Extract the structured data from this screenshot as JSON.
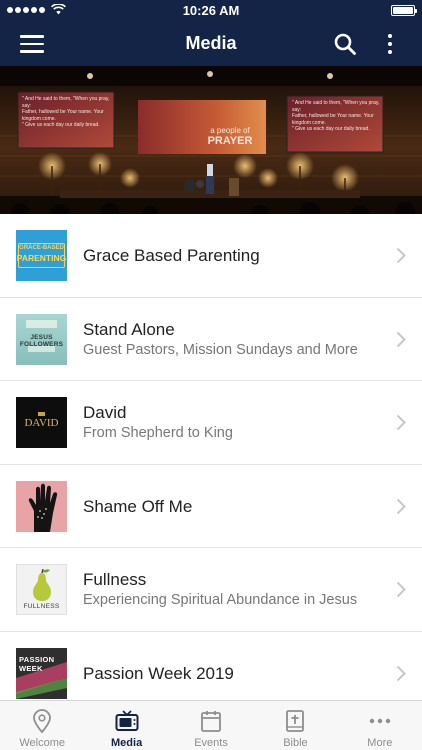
{
  "status_bar": {
    "time": "10:26 AM"
  },
  "nav": {
    "title": "Media"
  },
  "hero": {
    "screen_left_lines": [
      "\" And He said to them, \"When you pray, say:",
      "Father, hallowed be Your name. Your kingdom come.",
      "\" Give us each day our daily bread."
    ],
    "screen_center_top": "a people of",
    "screen_center_word": "PRAYER",
    "screen_right_lines": [
      "\" And He said to them, \"When you pray, say:",
      "Father, hallowed be Your name. Your kingdom come.",
      "\" Give us each day our daily bread."
    ]
  },
  "media_items": [
    {
      "title": "Grace Based Parenting",
      "subtitle": "",
      "thumb": {
        "top": "GRACE-BASED",
        "main": "PARENTING",
        "bg": "#2f9fd8"
      }
    },
    {
      "title": "Stand Alone",
      "subtitle": "Guest Pastors, Mission Sundays and More",
      "thumb": {
        "top": "",
        "main": "JESUS FOLLOWERS",
        "bg": "#8fc9c6"
      }
    },
    {
      "title": "David",
      "subtitle": "From Shepherd to King",
      "thumb": {
        "top": "",
        "main": "DAVID",
        "bg": "#0d0d0d"
      }
    },
    {
      "title": "Shame Off Me",
      "subtitle": "",
      "thumb": {
        "top": "",
        "main": "",
        "bg": "#e7a3a6"
      }
    },
    {
      "title": "Fullness",
      "subtitle": "Experiencing Spiritual Abundance in Jesus",
      "thumb": {
        "top": "",
        "main": "FULLNESS",
        "bg": "#f2f2f2"
      }
    },
    {
      "title": "Passion Week 2019",
      "subtitle": "",
      "thumb": {
        "top": "PASSION",
        "main": "WEEK",
        "bg": "#3a3a3a"
      }
    }
  ],
  "tabs": [
    {
      "label": "Welcome",
      "icon": "location-pin-icon"
    },
    {
      "label": "Media",
      "icon": "tv-icon"
    },
    {
      "label": "Events",
      "icon": "calendar-icon"
    },
    {
      "label": "Bible",
      "icon": "bible-icon"
    },
    {
      "label": "More",
      "icon": "more-icon"
    }
  ],
  "colors": {
    "nav_bg": "#132447",
    "active_tab": "#132447",
    "inactive_tab": "#8e8e8e",
    "chevron": "#c7c7cc"
  }
}
